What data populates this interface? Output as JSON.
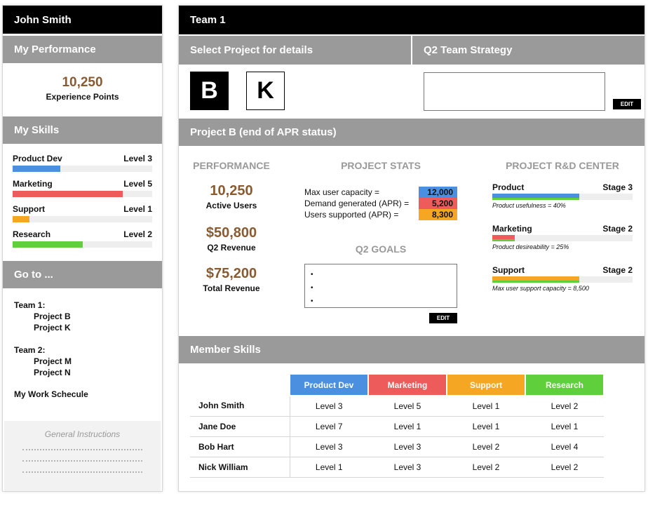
{
  "user": {
    "name": "John Smith"
  },
  "performance": {
    "header": "My Performance",
    "xp_value": "10,250",
    "xp_label": "Experience Points"
  },
  "skills": {
    "header": "My Skills",
    "items": [
      {
        "name": "Product Dev",
        "level": "Level 3",
        "fill": 0.34,
        "color": "#4a8fe0"
      },
      {
        "name": "Marketing",
        "level": "Level 5",
        "fill": 0.79,
        "color": "#ee5b5b"
      },
      {
        "name": "Support",
        "level": "Level 1",
        "fill": 0.12,
        "color": "#f5a623"
      },
      {
        "name": "Research",
        "level": "Level 2",
        "fill": 0.5,
        "color": "#5fcf3c"
      }
    ]
  },
  "goto": {
    "header": "Go to ...",
    "team1": "Team 1:",
    "team1_projects": [
      "Project B",
      "Project K"
    ],
    "team2": "Team 2:",
    "team2_projects": [
      "Project M",
      "Project N"
    ],
    "schedule": "My Work Schecule"
  },
  "instructions": {
    "title": "General Instructions"
  },
  "team": {
    "title": "Team 1",
    "select_label": "Select Project for details",
    "strategy_label": "Q2 Team Strategy",
    "btn_b": "B",
    "btn_k": "K",
    "edit": "EDIT"
  },
  "project": {
    "header": "Project B (end of APR status)",
    "performance_title": "PERFORMANCE",
    "active_users": "10,250",
    "active_users_label": "Active Users",
    "q2_revenue": "$50,800",
    "q2_revenue_label": "Q2 Revenue",
    "total_revenue": "$75,200",
    "total_revenue_label": "Total Revenue",
    "stats_title": "PROJECT STATS",
    "stats": [
      {
        "label": "Max user capacity =",
        "value": "12,000",
        "color": "#4a8fe0"
      },
      {
        "label": "Demand generated (APR) =",
        "value": "5,200",
        "color": "#ee5b5b"
      },
      {
        "label": "Users supported (APR) =",
        "value": "8,300",
        "color": "#f5a623"
      }
    ],
    "goals_title": "Q2 GOALS",
    "goals_bullets": [
      "•",
      "•",
      "•"
    ],
    "rd_title": "PROJECT R&D CENTER",
    "rd": [
      {
        "name": "Product",
        "stage": "Stage 3",
        "note": "Product usefulness = 40%",
        "fill": 0.62,
        "colors": [
          "#4a8fe0",
          "#5fcf3c"
        ]
      },
      {
        "name": "Marketing",
        "stage": "Stage 2",
        "note": "Product desireability = 25%",
        "fill": 0.16,
        "colors": [
          "#ee5b5b",
          "#5fcf3c"
        ]
      },
      {
        "name": "Support",
        "stage": "Stage 2",
        "note": "Max user support capacity =  8,500",
        "fill": 0.62,
        "colors": [
          "#f5a623",
          "#5fcf3c"
        ]
      }
    ]
  },
  "member_skills": {
    "header": "Member Skills",
    "columns": [
      {
        "label": "Product Dev",
        "color": "#4a8fe0"
      },
      {
        "label": "Marketing",
        "color": "#ee5b5b"
      },
      {
        "label": "Support",
        "color": "#f5a623"
      },
      {
        "label": "Research",
        "color": "#5fcf3c"
      }
    ],
    "rows": [
      {
        "name": "John Smith",
        "levels": [
          "Level 3",
          "Level 5",
          "Level 1",
          "Level 2"
        ]
      },
      {
        "name": "Jane Doe",
        "levels": [
          "Level 7",
          "Level 1",
          "Level 1",
          "Level 1"
        ]
      },
      {
        "name": "Bob Hart",
        "levels": [
          "Level 3",
          "Level 3",
          "Level 2",
          "Level 4"
        ]
      },
      {
        "name": "Nick William",
        "levels": [
          "Level 1",
          "Level 3",
          "Level 2",
          "Level 2"
        ]
      }
    ]
  }
}
